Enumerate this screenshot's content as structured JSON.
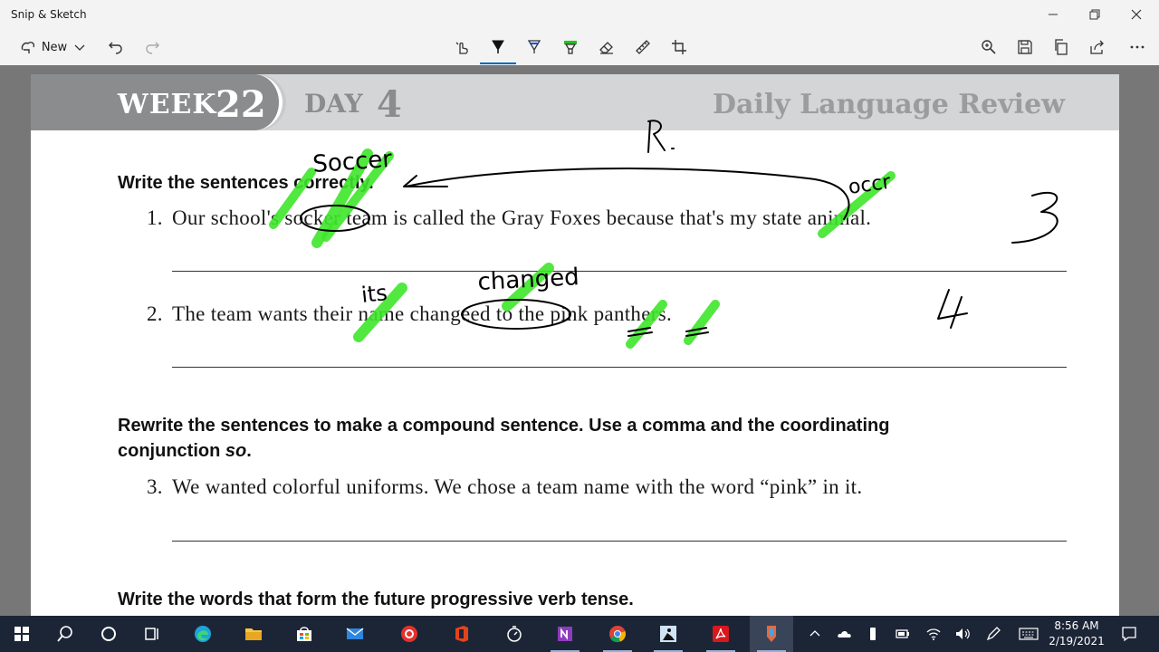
{
  "window": {
    "title": "Snip & Sketch"
  },
  "toolbar": {
    "new_label": "New"
  },
  "worksheet": {
    "header": {
      "week_word": "WEEK",
      "week_number": "22",
      "day_word": "DAY",
      "day_number": "4",
      "brand": "Daily Language Review"
    },
    "section1_instruction": "Write the sentences correctly.",
    "sentence1_number": "1.",
    "sentence1_text": "Our school's socker team is called the Gray Foxes because that's my state animal.",
    "sentence2_number": "2.",
    "sentence2_text": "The team wants their name changeed to the pink panthers.",
    "section2_instruction_line1": "Rewrite the sentences to make a compound sentence. Use a comma and the coordinating",
    "section2_instruction_line2_prefix": "conjunction ",
    "section2_instruction_line2_em": "so",
    "section2_instruction_line2_suffix": ".",
    "sentence3_number": "3.",
    "sentence3_text": "We wanted colorful uniforms. We chose a team name with the word “pink” in it.",
    "section3_instruction": "Write the words that form the future progressive verb tense."
  },
  "annotations": {
    "highlight_color": "#3ee62a",
    "ink_color": "#000000",
    "handwriting": [
      "Soccer",
      "R.",
      "occr",
      "3",
      "its",
      "changed",
      "4"
    ]
  },
  "taskbar": {
    "time": "8:56 AM",
    "date": "2/19/2021",
    "apps": [
      "start-icon",
      "search-icon",
      "cortana-icon",
      "task-view-icon",
      "edge-icon",
      "file-explorer-icon",
      "store-icon",
      "mail-icon",
      "screen-recorder-icon",
      "office-icon",
      "timer-icon",
      "onenote-icon",
      "chrome-icon",
      "kindle-icon",
      "acrobat-icon",
      "snip-sketch-icon"
    ]
  }
}
